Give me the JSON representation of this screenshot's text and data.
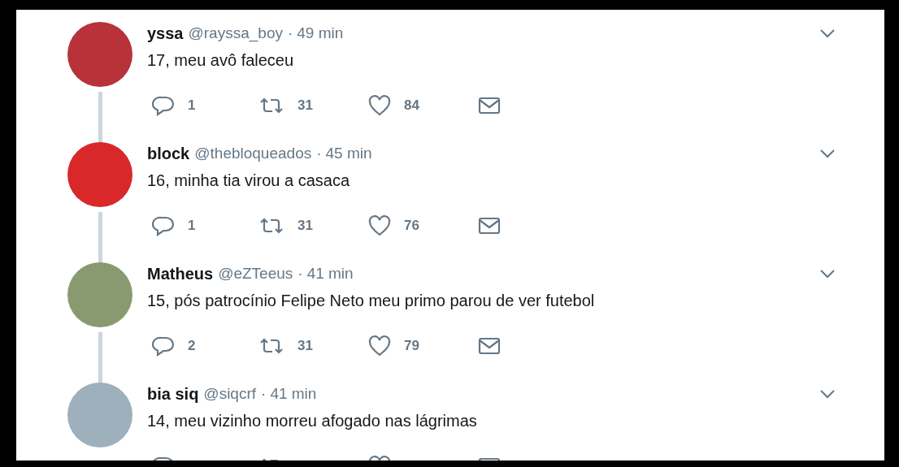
{
  "tweets": [
    {
      "name": "yssa",
      "handle": "@rayssa_boy",
      "separator": "·",
      "time": "49 min",
      "text": "17, meu avô faleceu",
      "replies": "1",
      "retweets": "31",
      "likes": "84"
    },
    {
      "name": "block",
      "handle": "@thebloqueados",
      "separator": "·",
      "time": "45 min",
      "text": "16, minha tia virou a casaca",
      "replies": "1",
      "retweets": "31",
      "likes": "76"
    },
    {
      "name": "Matheus",
      "handle": "@eZTeeus",
      "separator": "·",
      "time": "41 min",
      "text": "15, pós patrocínio Felipe Neto meu primo parou de ver futebol",
      "replies": "2",
      "retweets": "31",
      "likes": "79"
    },
    {
      "name": "bia siq",
      "handle": "@siqcrf",
      "separator": "·",
      "time": "41 min",
      "text": "14, meu vizinho morreu afogado nas lágrimas"
    }
  ]
}
